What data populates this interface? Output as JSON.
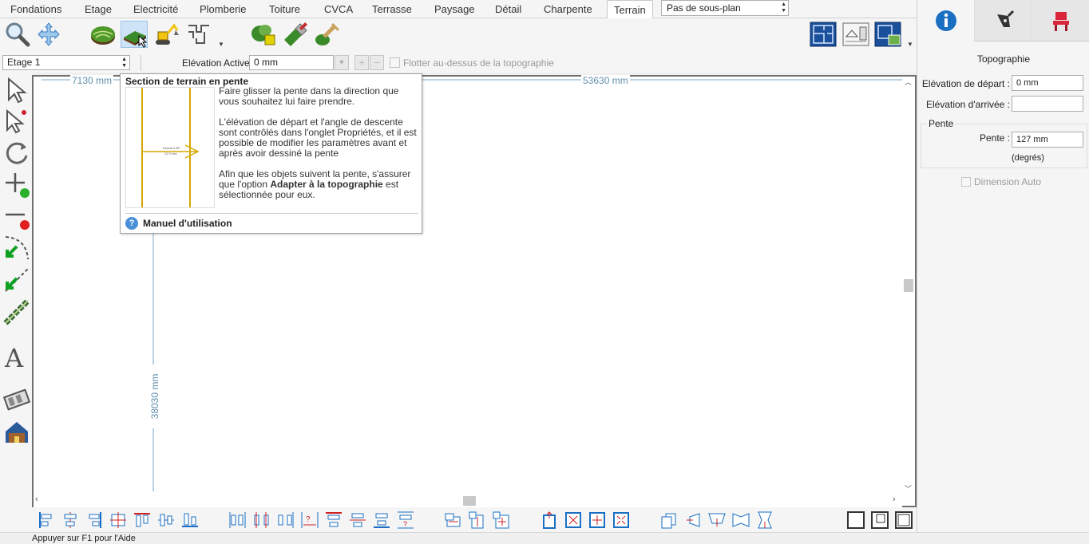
{
  "tabs": [
    {
      "label": "Fondations",
      "active": false
    },
    {
      "label": "Etage",
      "active": false
    },
    {
      "label": "Electricité",
      "active": false
    },
    {
      "label": "Plomberie",
      "active": false
    },
    {
      "label": "Toiture",
      "active": false
    },
    {
      "label": "CVCA",
      "active": false
    },
    {
      "label": "Terrasse",
      "active": false
    },
    {
      "label": "Paysage",
      "active": false
    },
    {
      "label": "Détail",
      "active": false
    },
    {
      "label": "Charpente",
      "active": false
    },
    {
      "label": "Terrain",
      "active": true
    }
  ],
  "subplan_select": {
    "value": "Pas de sous-plan"
  },
  "toolbar": {
    "icons": [
      "zoom-icon",
      "pan-icon",
      "terrain-shape-icon",
      "slope-section-icon",
      "excavator-icon",
      "path-icon",
      "plant-icon",
      "brush-icon",
      "paint-roller-icon",
      "plan-view-icon",
      "elevation-view-icon",
      "site-view-icon"
    ]
  },
  "options": {
    "level_value": "Etage 1",
    "elevation_label": "Elévation Active:",
    "elevation_value": "0 mm",
    "float_label": "Flotter au-dessus de la topographie"
  },
  "canvas": {
    "dim_top_left": "7130 mm",
    "dim_top": "53630 mm",
    "dim_vertical": "38030 mm"
  },
  "tooltip": {
    "title": "Section de terrain en pente",
    "para1": "Faire glisser la pente dans la direction que vous souhaitez lui faire prendre.",
    "para2": "L'élévation de départ et l'angle de descente sont contrôlés dans l'onglet Propriétés, et il est possible de modifier les paramètres avant et après avoir dessiné la pente",
    "para3_a": "Afin que les objets suivent la pente, s'assurer que l'option ",
    "para3_b": "Adapter à la topographie",
    "para3_c": " est sélectionnée pour eux.",
    "help_label": "Manuel d'utilisation",
    "preview_label": "Descent 45°",
    "preview_sublabel": "127.0 mm"
  },
  "status": {
    "text": "Appuyer sur F1 pour l'Aide"
  },
  "right_panel": {
    "tabs": [
      "info-icon",
      "pen-icon",
      "chair-icon"
    ],
    "heading": "Topographie",
    "start_label": "Elévation de départ :",
    "start_value": "0 mm",
    "end_label": "Elévation d'arrivée :",
    "end_value": "",
    "group_label": "Pente",
    "slope_label": "Pente :",
    "slope_value": "127 mm",
    "slope_unit": "(degrés)",
    "auto_label": "Dimension Auto"
  },
  "colors": {
    "accent_blue": "#1b6fc2",
    "terrain_green": "#3a8a2a",
    "dimension_line": "#5f8fae",
    "tooltip_yellow": "#d4a800"
  }
}
